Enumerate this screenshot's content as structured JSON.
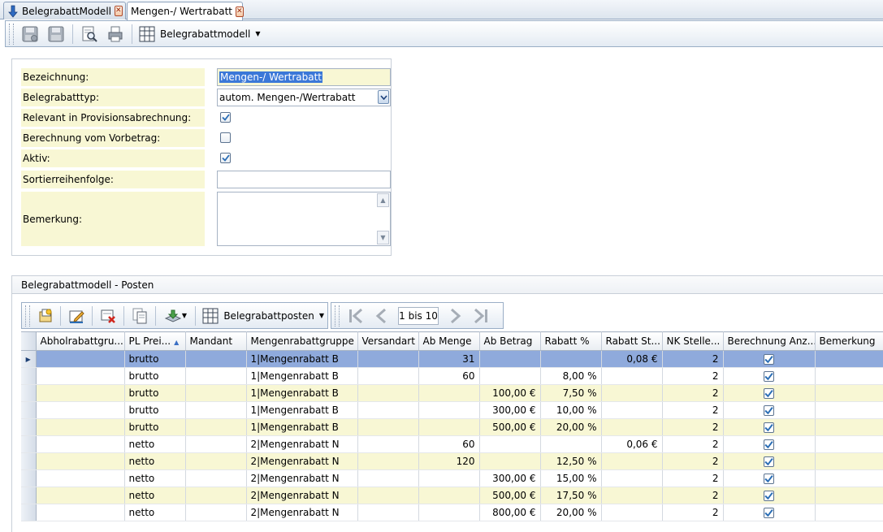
{
  "tabs": [
    {
      "label": "BelegrabattModell",
      "active": false
    },
    {
      "label": "Mengen-/ Wertrabatt",
      "active": true
    }
  ],
  "toolbar": {
    "model_dropdown_label": "Belegrabattmodell"
  },
  "form": {
    "bezeichnung_label": "Bezeichnung:",
    "bezeichnung_value": "Mengen-/ Wertrabatt",
    "typ_label": "Belegrabatttyp:",
    "typ_value": "autom. Mengen-/Wertrabatt",
    "provision_label": "Relevant in Provisionsabrechnung:",
    "provision_checked": true,
    "vorbetrag_label": "Berechnung vom Vorbetrag:",
    "vorbetrag_checked": false,
    "aktiv_label": "Aktiv:",
    "aktiv_checked": true,
    "sortierung_label": "Sortierreihenfolge:",
    "sortierung_value": "",
    "bemerkung_label": "Bemerkung:",
    "bemerkung_value": ""
  },
  "posten": {
    "section_title": "Belegrabattmodell - Posten",
    "posten_dropdown_label": "Belegrabattposten",
    "pager_value": "1 bis 10",
    "columns": [
      "Abholrabattgru...",
      "PL Prei...",
      "Mandant",
      "Mengenrabattgruppe",
      "Versandart",
      "Ab Menge",
      "Ab Betrag",
      "Rabatt %",
      "Rabatt St...",
      "NK Stelle...",
      "Berechnung Anz...",
      "Bemerkung"
    ],
    "rows": [
      {
        "abhol": "",
        "pl": "brutto",
        "mandant": "",
        "gruppe": "1|Mengenrabatt B",
        "versand": "",
        "menge": "31",
        "betrag": "",
        "rabatt": "",
        "rabatt_st": "0,08 €",
        "nk": "2",
        "berechnung": true,
        "bemerkung": "",
        "selected": true
      },
      {
        "abhol": "",
        "pl": "brutto",
        "mandant": "",
        "gruppe": "1|Mengenrabatt B",
        "versand": "",
        "menge": "60",
        "betrag": "",
        "rabatt": "8,00 %",
        "rabatt_st": "",
        "nk": "2",
        "berechnung": true,
        "bemerkung": ""
      },
      {
        "abhol": "",
        "pl": "brutto",
        "mandant": "",
        "gruppe": "1|Mengenrabatt B",
        "versand": "",
        "menge": "",
        "betrag": "100,00 €",
        "rabatt": "7,50 %",
        "rabatt_st": "",
        "nk": "2",
        "berechnung": true,
        "bemerkung": ""
      },
      {
        "abhol": "",
        "pl": "brutto",
        "mandant": "",
        "gruppe": "1|Mengenrabatt B",
        "versand": "",
        "menge": "",
        "betrag": "300,00 €",
        "rabatt": "10,00 %",
        "rabatt_st": "",
        "nk": "2",
        "berechnung": true,
        "bemerkung": ""
      },
      {
        "abhol": "",
        "pl": "brutto",
        "mandant": "",
        "gruppe": "1|Mengenrabatt B",
        "versand": "",
        "menge": "",
        "betrag": "500,00 €",
        "rabatt": "20,00 %",
        "rabatt_st": "",
        "nk": "2",
        "berechnung": true,
        "bemerkung": ""
      },
      {
        "abhol": "",
        "pl": "netto",
        "mandant": "",
        "gruppe": "2|Mengenrabatt N",
        "versand": "",
        "menge": "60",
        "betrag": "",
        "rabatt": "",
        "rabatt_st": "0,06 €",
        "nk": "2",
        "berechnung": true,
        "bemerkung": ""
      },
      {
        "abhol": "",
        "pl": "netto",
        "mandant": "",
        "gruppe": "2|Mengenrabatt N",
        "versand": "",
        "menge": "120",
        "betrag": "",
        "rabatt": "12,50 %",
        "rabatt_st": "",
        "nk": "2",
        "berechnung": true,
        "bemerkung": ""
      },
      {
        "abhol": "",
        "pl": "netto",
        "mandant": "",
        "gruppe": "2|Mengenrabatt N",
        "versand": "",
        "menge": "",
        "betrag": "300,00 €",
        "rabatt": "15,00 %",
        "rabatt_st": "",
        "nk": "2",
        "berechnung": true,
        "bemerkung": ""
      },
      {
        "abhol": "",
        "pl": "netto",
        "mandant": "",
        "gruppe": "2|Mengenrabatt N",
        "versand": "",
        "menge": "",
        "betrag": "500,00 €",
        "rabatt": "17,50 %",
        "rabatt_st": "",
        "nk": "2",
        "berechnung": true,
        "bemerkung": ""
      },
      {
        "abhol": "",
        "pl": "netto",
        "mandant": "",
        "gruppe": "2|Mengenrabatt N",
        "versand": "",
        "menge": "",
        "betrag": "800,00 €",
        "rabatt": "20,00 %",
        "rabatt_st": "",
        "nk": "2",
        "berechnung": true,
        "bemerkung": ""
      }
    ]
  },
  "colors": {
    "label_bg": "#f8f7d4",
    "selected_row": "#8faadc",
    "selection_text_bg": "#3b78d8",
    "check_color": "#2a6db5"
  }
}
